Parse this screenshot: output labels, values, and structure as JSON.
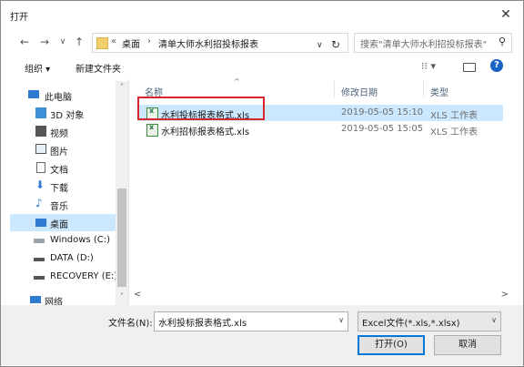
{
  "window": {
    "title": "打开",
    "close_glyph": "✕"
  },
  "nav": {
    "back_glyph": "←",
    "forward_glyph": "→",
    "recent_glyph": "∨",
    "up_glyph": "↑",
    "crumb_chevron": "«",
    "crumb_1": "桌面",
    "crumb_sep": "›",
    "crumb_2": "清单大师水利招投标报表",
    "address_dropdown_glyph": "∨",
    "refresh_glyph": "↻",
    "search_placeholder": "搜索\"清单大师水利招投标报表\"",
    "search_glyph": "⚲"
  },
  "toolbar": {
    "organize_label": "组织 ▾",
    "new_folder_label": "新建文件夹",
    "view_glyph": "⁝⁝ ▾",
    "help_glyph": "?"
  },
  "sidebar": {
    "items": [
      {
        "label": "此电脑",
        "icon": "computer-icon"
      },
      {
        "label": "3D 对象",
        "icon": "cube-icon"
      },
      {
        "label": "视频",
        "icon": "video-icon"
      },
      {
        "label": "图片",
        "icon": "picture-icon"
      },
      {
        "label": "文档",
        "icon": "document-icon"
      },
      {
        "label": "下载",
        "icon": "download-icon"
      },
      {
        "label": "音乐",
        "icon": "music-icon"
      },
      {
        "label": "桌面",
        "icon": "desktop-icon"
      },
      {
        "label": "Windows (C:)",
        "icon": "drive-icon"
      },
      {
        "label": "DATA (D:)",
        "icon": "drive-icon"
      },
      {
        "label": "RECOVERY (E:)",
        "icon": "drive-icon"
      },
      {
        "label": "网络",
        "icon": "network-icon"
      }
    ],
    "selected_index": 7
  },
  "columns": {
    "name": "名称",
    "modified": "修改日期",
    "type": "类型",
    "sort_glyph": "^"
  },
  "files": [
    {
      "name": "水利投标报表格式.xls",
      "modified": "2019-05-05 15:10",
      "type": "XLS 工作表"
    },
    {
      "name": "水利招标报表格式.xls",
      "modified": "2019-05-05 15:05",
      "type": "XLS 工作表"
    }
  ],
  "scroll": {
    "up_glyph": "˄",
    "down_glyph": "˅",
    "left_glyph": "<",
    "right_glyph": ">"
  },
  "footer": {
    "filename_label": "文件名(N):",
    "filename_value": "水利投标报表格式.xls",
    "filter_value": "Excel文件(*.xls,*.xlsx)",
    "dropdown_glyph": "∨",
    "open_label": "打开(O)",
    "cancel_label": "取消"
  },
  "colors": {
    "selection": "#cce8ff",
    "highlight_box": "#d9262e",
    "accent": "#0078d7"
  }
}
